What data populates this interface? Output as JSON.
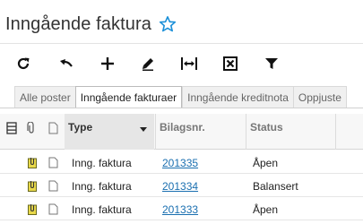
{
  "page": {
    "title": "Inngående faktura",
    "favorite_icon": "star-outline-icon",
    "accent": "#1a8fd8"
  },
  "toolbar": [
    {
      "name": "refresh-icon"
    },
    {
      "name": "undo-icon"
    },
    {
      "name": "add-icon"
    },
    {
      "name": "edit-icon"
    },
    {
      "name": "fit-width-icon"
    },
    {
      "name": "export-excel-icon"
    },
    {
      "name": "filter-icon"
    }
  ],
  "tabs": [
    {
      "label": "Alle poster"
    },
    {
      "label": "Inngående fakturaer"
    },
    {
      "label": "Inngående kreditnota"
    },
    {
      "label": "Oppjuste"
    }
  ],
  "grid": {
    "columns": {
      "type": "Type",
      "bilag": "Bilagsnr.",
      "status": "Status"
    },
    "rows": [
      {
        "type": "Inng. faktura",
        "bilag": "201335",
        "status": "Åpen"
      },
      {
        "type": "Inng. faktura",
        "bilag": "201334",
        "status": "Balansert"
      },
      {
        "type": "Inng. faktura",
        "bilag": "201333",
        "status": "Åpen"
      }
    ]
  }
}
